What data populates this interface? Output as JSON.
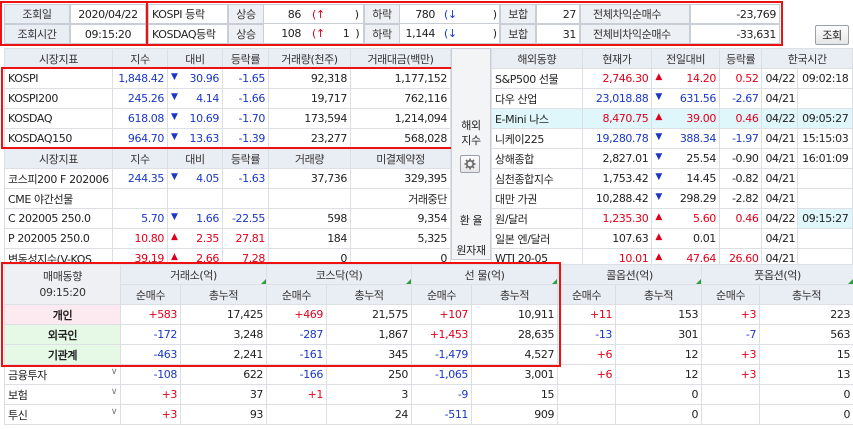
{
  "top": {
    "date_label": "조회일",
    "date_value": "2020/04/22",
    "time_label": "조회시간",
    "time_value": "09:15:20",
    "kospi_label": "KOSPI 등락",
    "kosdaq_label": "KOSDAQ등락",
    "up_label": "상승",
    "down_label": "하락",
    "flat_label": "보합",
    "kospi_up": "86",
    "kospi_up_sym": "(↑",
    "kospi_up_count": ")",
    "kospi_down": "780",
    "kospi_down_sym": "(↓",
    "kospi_down_close": ")",
    "kospi_flat": "27",
    "kosdaq_up": "108",
    "kosdaq_up_sym": "(↑",
    "kosdaq_up_n": "1",
    "kosdaq_up_close": ")",
    "kosdaq_down": "1,144",
    "kosdaq_down_sym": "(↓",
    "kosdaq_down_close": ")",
    "kosdaq_flat": "31",
    "arb_label": "전체차익순매수",
    "arb_value": "-23,769",
    "nonarb_label": "전체비차익순매수",
    "nonarb_value": "-33,631",
    "refresh_button": "조회"
  },
  "market": {
    "headers": [
      "시장지표",
      "지수",
      "대비",
      "등락률",
      "거래량(천주)",
      "거래대금(백만)"
    ],
    "rows": [
      {
        "name": "KOSPI",
        "index": "1,848.42",
        "arrow": "▼",
        "change": "30.96",
        "rate": "-1.65",
        "volume": "92,318",
        "amount": "1,177,152"
      },
      {
        "name": "KOSPI200",
        "index": "245.26",
        "arrow": "▼",
        "change": "4.14",
        "rate": "-1.66",
        "volume": "19,717",
        "amount": "762,116"
      },
      {
        "name": "KOSDAQ",
        "index": "618.08",
        "arrow": "▼",
        "change": "10.69",
        "rate": "-1.70",
        "volume": "173,594",
        "amount": "1,214,094"
      },
      {
        "name": "KOSDAQ150",
        "index": "964.70",
        "arrow": "▼",
        "change": "13.63",
        "rate": "-1.39",
        "volume": "23,277",
        "amount": "568,028"
      }
    ]
  },
  "futures": {
    "headers": [
      "시장지표",
      "지수",
      "대비",
      "등락률",
      "거래량",
      "미결제약정"
    ],
    "rows": [
      {
        "name": "코스피200 F 202006",
        "index": "244.35",
        "arrow": "▼",
        "change": "4.05",
        "rate": "-1.63",
        "volume": "37,736",
        "oi": "329,395"
      },
      {
        "name": "CME 야간선물",
        "index": "",
        "arrow": "",
        "change": "",
        "rate": "",
        "volume": "",
        "oi": "거래중단"
      },
      {
        "name": "C 202005 250.0",
        "index": "5.70",
        "arrow": "▼",
        "change": "1.66",
        "rate": "-22.55",
        "volume": "598",
        "oi": "9,354"
      },
      {
        "name": "P 202005 250.0",
        "index": "10.80",
        "arrow": "▲",
        "change": "2.35",
        "rate": "27.81",
        "volume": "184",
        "oi": "5,325"
      },
      {
        "name": "변동성지수(V-KOS",
        "index": "39.19",
        "arrow": "▲",
        "change": "2.66",
        "rate": "7.28",
        "volume": "0",
        "oi": "0"
      }
    ]
  },
  "side_buttons": {
    "overseas_label_1": "해외",
    "overseas_label_2": "지수",
    "exchange_label": "환 율",
    "commodity_label": "원자재"
  },
  "overseas": {
    "headers": [
      "해외동향",
      "현재가",
      "전일대비",
      "등락률",
      "한국시간"
    ],
    "rows": [
      {
        "name": "S&P500 선물",
        "price": "2,746.30",
        "arrow": "▲",
        "change": "14.20",
        "rate": "0.52",
        "date": "04/22",
        "time": "09:02:18",
        "color": "red"
      },
      {
        "name": "다우 산업",
        "price": "23,018.88",
        "arrow": "▼",
        "change": "631.56",
        "rate": "-2.67",
        "date": "04/21",
        "time": "",
        "color": "blue"
      },
      {
        "name": "E-Mini 나스",
        "price": "8,470.75",
        "arrow": "▲",
        "change": "39.00",
        "rate": "0.46",
        "date": "04/22",
        "time": "09:05:27",
        "color": "red"
      },
      {
        "name": "니케이225",
        "price": "19,280.78",
        "arrow": "▼",
        "change": "388.34",
        "rate": "-1.97",
        "date": "04/21",
        "time": "15:15:03",
        "color": "blue"
      },
      {
        "name": "상해종합",
        "price": "2,827.01",
        "arrow": "▼",
        "change": "25.54",
        "rate": "-0.90",
        "date": "04/21",
        "time": "16:01:09",
        "color": "black"
      },
      {
        "name": "심천종합지수",
        "price": "1,753.42",
        "arrow": "▼",
        "change": "14.45",
        "rate": "-0.82",
        "date": "04/21",
        "time": "",
        "color": "black"
      },
      {
        "name": "대만 가권",
        "price": "10,288.42",
        "arrow": "▼",
        "change": "298.29",
        "rate": "-2.82",
        "date": "04/21",
        "time": "",
        "color": "black"
      },
      {
        "name": "원/달러",
        "price": "1,235.30",
        "arrow": "▲",
        "change": "5.60",
        "rate": "0.46",
        "date": "04/22",
        "time": "09:15:27",
        "color": "red"
      },
      {
        "name": "일본 엔/달러",
        "price": "107.63",
        "arrow": "▲",
        "change": "0.01",
        "rate": "",
        "date": "04/21",
        "time": "",
        "color": "black"
      },
      {
        "name": "WTI 20-05",
        "price": "10.01",
        "arrow": "▲",
        "change": "47.64",
        "rate": "26.60",
        "date": "04/21",
        "time": "",
        "color": "red"
      }
    ]
  },
  "investor": {
    "title": "매매동향",
    "time": "09:15:20",
    "groups": [
      "거래소(억)",
      "코스닥(억)",
      "선 물(억)",
      "콜옵션(억)",
      "풋옵션(억)"
    ],
    "sub": [
      "순매수",
      "총누적"
    ],
    "rows": [
      {
        "name": "개인",
        "style": "pink",
        "vals": [
          "+583",
          "17,425",
          "+469",
          "21,575",
          "+107",
          "10,911",
          "+11",
          "153",
          "+3",
          "223"
        ]
      },
      {
        "name": "외국인",
        "style": "mint",
        "vals": [
          "-172",
          "3,248",
          "-287",
          "1,867",
          "+1,453",
          "28,635",
          "-13",
          "301",
          "-7",
          "563"
        ]
      },
      {
        "name": "기관계",
        "style": "mint",
        "vals": [
          "-463",
          "2,241",
          "-161",
          "345",
          "-1,479",
          "4,527",
          "+6",
          "12",
          "+3",
          "15"
        ]
      },
      {
        "name": "금융투자",
        "style": "plain",
        "vals": [
          "-108",
          "622",
          "-166",
          "250",
          "-1,065",
          "3,001",
          "+6",
          "12",
          "+3",
          "13"
        ]
      },
      {
        "name": "보험",
        "style": "plain",
        "vals": [
          "+3",
          "37",
          "+1",
          "3",
          "-9",
          "15",
          "",
          "0",
          "",
          "0"
        ]
      },
      {
        "name": "투신",
        "style": "plain",
        "vals": [
          "+3",
          "93",
          "",
          "24",
          "-511",
          "909",
          "",
          "0",
          "",
          "0"
        ]
      }
    ]
  }
}
